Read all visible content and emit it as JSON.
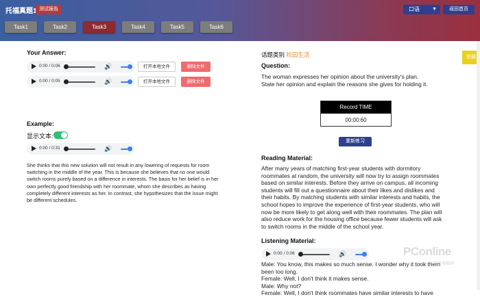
{
  "header": {
    "title": "托福真题1",
    "report_button": "测试报告",
    "language_select": "口语",
    "home_button": "返回首页"
  },
  "tasks": [
    "Task1",
    "Task2",
    "Task3",
    "Task4",
    "Task5",
    "Task6"
  ],
  "active_task": "Task3",
  "answer": {
    "label": "Your Answer:",
    "recordings": [
      {
        "time": "0:00 / 0:06",
        "open_label": "打开本地文件",
        "delete_label": "删除文件"
      },
      {
        "time": "0:00 / 0:05",
        "open_label": "打开本地文件",
        "delete_label": "删除文件"
      }
    ]
  },
  "example": {
    "label": "Example:",
    "show_text_label": "显示文本:",
    "show_text_on": true,
    "audio_time": "0:00 / 0:31",
    "text_lines": [
      "She thinks that this new solution will not result in any lowering of requests for room",
      "switching in the middle of the year. This is because she believes that no one would",
      "switch rooms purely based on a difference in interests. The basis for her belief is in her",
      "own perfectly good friendship with her roommate, whom she describes as having",
      "completely different interests as her. In contrast, she hypothesizes that the issue might",
      "be different schedules."
    ]
  },
  "topic": {
    "label": "话题类别",
    "value": "校园生活"
  },
  "question": {
    "label": "Question:",
    "lines": [
      "The woman expresses her opinion about the university's plan.",
      "State her opinion and explain the reasons she gives for holding it."
    ]
  },
  "record": {
    "header": "Record TIME",
    "time": "00:00:60",
    "retry_button": "重新练习"
  },
  "side_tab": "拍摄",
  "reading": {
    "label": "Reading Material:",
    "lines": [
      "After many years of matching first-year students with dormitory",
      "roommates at random, the university will now try to assign roommates",
      "based on similar interests. Before they arrive on campus, all incoming",
      "students will fill out a questionnaire about their likes and dislikes and",
      "their habits. By matching students with similar interests and habits, the",
      "school hopes to improve the experience of first-year students, who will",
      "now be more likely to get along well with their roommates. The plan will",
      "also reduce work for the housing office because fewer students will ask",
      "to switch rooms in the middle of the school year."
    ]
  },
  "listening": {
    "label": "Listening Material:",
    "audio_time": "0:00 / 0:06",
    "lines": [
      "Male: You know, this makes so much sense. I wonder why it took them",
      "been too long.",
      "Female: Well, I don't think it makes sense.",
      "Male: Why not?",
      "Female: Well, I don't think roommates have similar interests to have"
    ]
  },
  "watermark": {
    "brand": "PConline",
    "sub": "太平洋电脑网"
  },
  "colors": {
    "header_left": "#3a5fa0",
    "header_right": "#9b2f3e",
    "active_task": "#8e2a30",
    "delete_button": "#ee6b6e",
    "topic_accent": "#e8903a",
    "toggle_on": "#2fbf71",
    "primary_button": "#2e3f8f"
  }
}
